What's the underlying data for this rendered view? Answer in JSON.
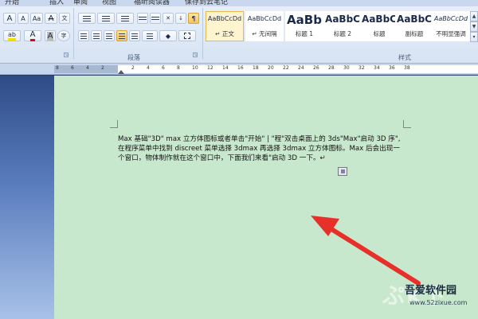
{
  "ribbon": {
    "tabs": [
      "开始",
      "插入",
      "审阅",
      "视图",
      "福昕阅读器",
      "保存到云笔记"
    ],
    "font_group": {
      "buttons": [
        "A",
        "A",
        "Aa",
        "A",
        "A",
        "A"
      ]
    },
    "paragraph_group": {
      "label": "段落"
    },
    "styles_group": {
      "label": "样式",
      "items": [
        {
          "preview": "AaBbCcDd",
          "name": "↵ 正文",
          "selected": true
        },
        {
          "preview": "AaBbCcDd",
          "name": "↵ 无间隔",
          "selected": false
        },
        {
          "preview": "AaBb",
          "name": "标题 1",
          "selected": false
        },
        {
          "preview": "AaBbC",
          "name": "标题 2",
          "selected": false
        },
        {
          "preview": "AaBbC",
          "name": "标题",
          "selected": false
        },
        {
          "preview": "AaBbC",
          "name": "副标题",
          "selected": false
        },
        {
          "preview": "AaBbCcDd",
          "name": "不明显强调",
          "selected": false
        }
      ]
    }
  },
  "ruler": {
    "numbers": [
      "8",
      "6",
      "4",
      "2",
      "",
      "2",
      "4",
      "6",
      "8",
      "10",
      "12",
      "14",
      "16",
      "18",
      "20",
      "22",
      "24",
      "26",
      "28",
      "30",
      "32",
      "34",
      "36",
      "38"
    ]
  },
  "document": {
    "lines": [
      "Max 基础\"3D\"  max 立方体图标或者单击\"开始\" | \"程\"双击桌面上的 3ds\"Max\"启动 3D 序\",",
      "在程序菜单中找到 discreet 菜单选择 3dmax 再选择 3dmax 立方体图标。Max 后会出现一",
      "个窗口，物体制作就在这个窗口中，下面我们来看\"启动 3D 一下。↵"
    ]
  },
  "watermark": {
    "site": "吾爱软件园",
    "url": "www.52zixue.com"
  },
  "colors": {
    "page_bg": "#c8e8cd",
    "arrow": "#e8302a",
    "ribbon_bg": "#dbe6f4"
  }
}
